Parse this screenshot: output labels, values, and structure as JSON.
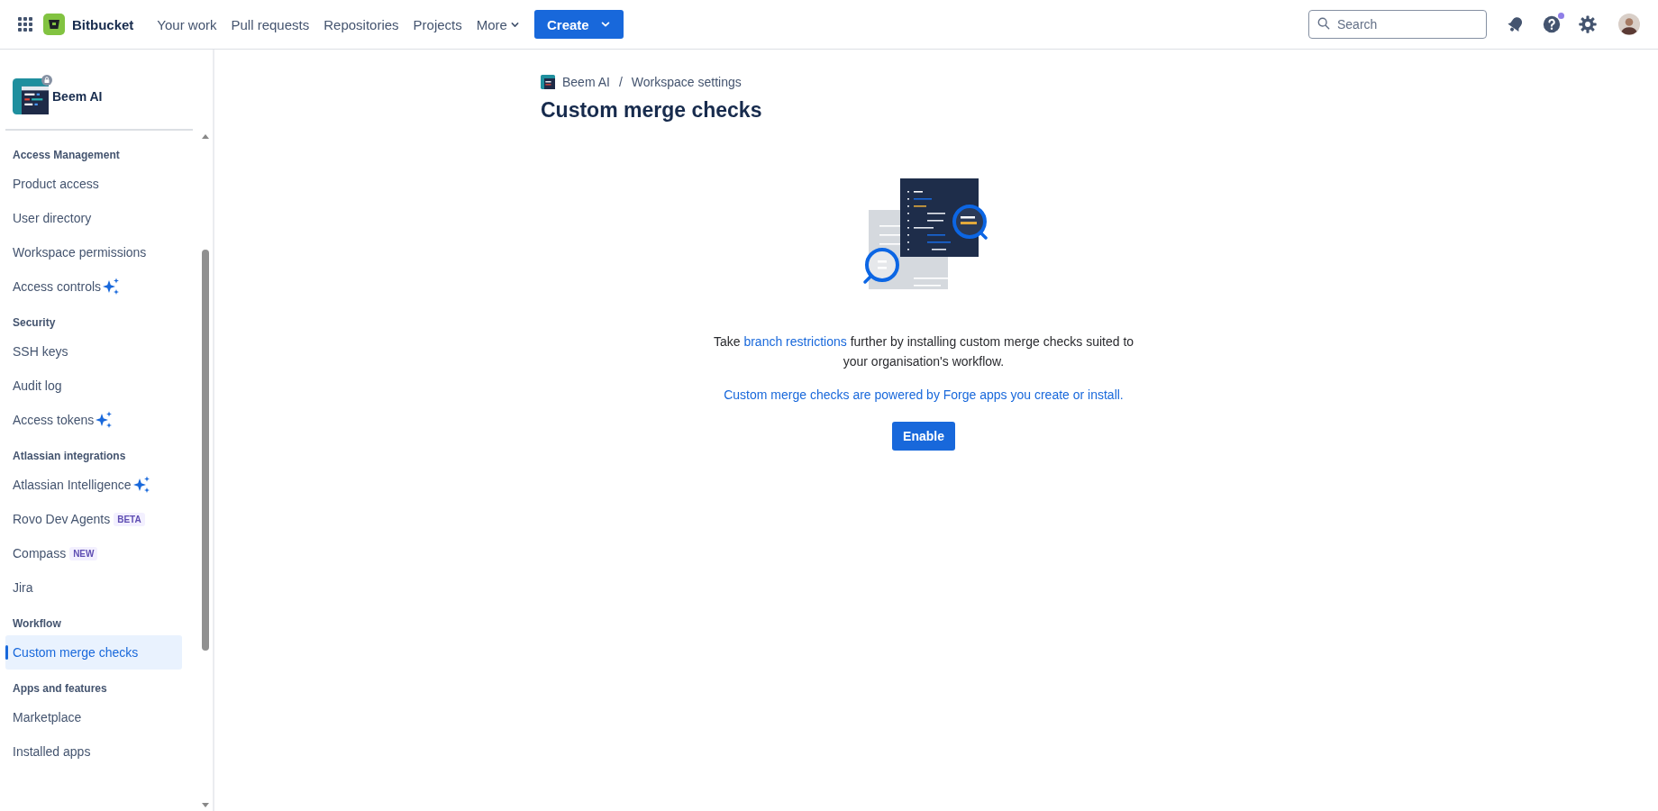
{
  "top_nav": {
    "product": "Bitbucket",
    "links": [
      {
        "label": "Your work"
      },
      {
        "label": "Pull requests"
      },
      {
        "label": "Repositories"
      },
      {
        "label": "Projects"
      }
    ],
    "more": "More",
    "create": "Create",
    "search": {
      "placeholder": "Search"
    }
  },
  "sidebar": {
    "workspace": "Beem AI",
    "sections": [
      {
        "title": "Access Management",
        "items": [
          {
            "label": "Product access",
            "selected": false,
            "sparkle": false
          },
          {
            "label": "User directory",
            "selected": false,
            "sparkle": false
          },
          {
            "label": "Workspace permissions",
            "selected": false,
            "sparkle": false
          },
          {
            "label": "Access controls",
            "selected": false,
            "sparkle": true
          }
        ]
      },
      {
        "title": "Security",
        "items": [
          {
            "label": "SSH keys",
            "selected": false,
            "sparkle": false
          },
          {
            "label": "Audit log",
            "selected": false,
            "sparkle": false
          },
          {
            "label": "Access tokens",
            "selected": false,
            "sparkle": true
          }
        ]
      },
      {
        "title": "Atlassian integrations",
        "items": [
          {
            "label": "Atlassian Intelligence",
            "selected": false,
            "sparkle": true
          },
          {
            "label": "Rovo Dev Agents",
            "selected": false,
            "sparkle": false,
            "badge": "BETA"
          },
          {
            "label": "Compass",
            "selected": false,
            "sparkle": false,
            "badge": "NEW"
          },
          {
            "label": "Jira",
            "selected": false,
            "sparkle": false
          }
        ]
      },
      {
        "title": "Workflow",
        "items": [
          {
            "label": "Custom merge checks",
            "selected": true,
            "sparkle": false
          }
        ]
      },
      {
        "title": "Apps and features",
        "items": [
          {
            "label": "Marketplace",
            "selected": false,
            "sparkle": false
          },
          {
            "label": "Installed apps",
            "selected": false,
            "sparkle": false
          }
        ]
      }
    ]
  },
  "breadcrumbs": [
    {
      "label": "Beem AI"
    },
    {
      "label": "Workspace settings"
    }
  ],
  "breadcrumb_separator": "/",
  "title": "Custom merge checks",
  "empty_state": {
    "description_parts": [
      {
        "text": "Take ",
        "link": false
      },
      {
        "text": "branch restrictions",
        "link": true
      },
      {
        "text": " further by installing custom merge checks suited to your organisation's workflow.",
        "link": false
      }
    ],
    "forge_link": "Custom merge checks are powered by Forge apps you create or install.",
    "button": "Enable"
  }
}
